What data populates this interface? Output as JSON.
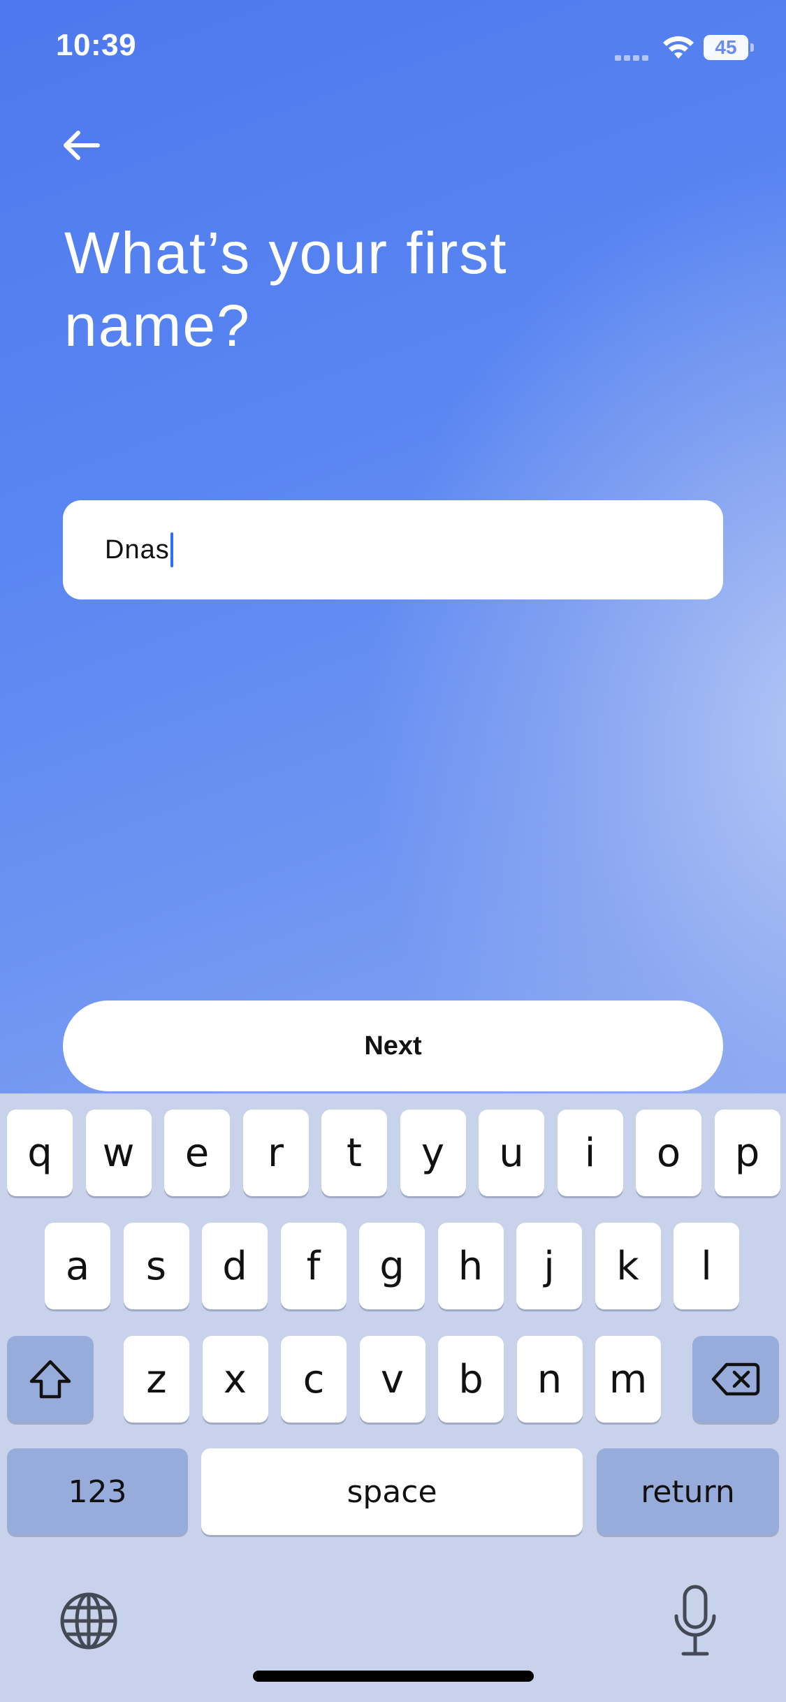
{
  "status_bar": {
    "time": "10:39",
    "battery_level": "45",
    "icons": [
      "signal-icon",
      "wifi-icon",
      "battery-icon"
    ]
  },
  "header": {
    "back_icon": "arrow-left-icon",
    "title": "What’s your first name?"
  },
  "form": {
    "name_value": "Dnas"
  },
  "actions": {
    "next_label": "Next"
  },
  "keyboard": {
    "row1": [
      "q",
      "w",
      "e",
      "r",
      "t",
      "y",
      "u",
      "i",
      "o",
      "p"
    ],
    "row2": [
      "a",
      "s",
      "d",
      "f",
      "g",
      "h",
      "j",
      "k",
      "l"
    ],
    "row3": [
      "z",
      "x",
      "c",
      "v",
      "b",
      "n",
      "m"
    ],
    "shift_icon": "shift-icon",
    "delete_icon": "backspace-icon",
    "numbers_label": "123",
    "space_label": "space",
    "return_label": "return",
    "globe_icon": "globe-icon",
    "mic_icon": "microphone-icon"
  },
  "colors": {
    "background_top": "#4d78ee",
    "background_light": "#b9cbf5",
    "keyboard_bg": "#c8d2ea",
    "special_key": "#98acdb",
    "cursor": "#2f6ff2"
  }
}
